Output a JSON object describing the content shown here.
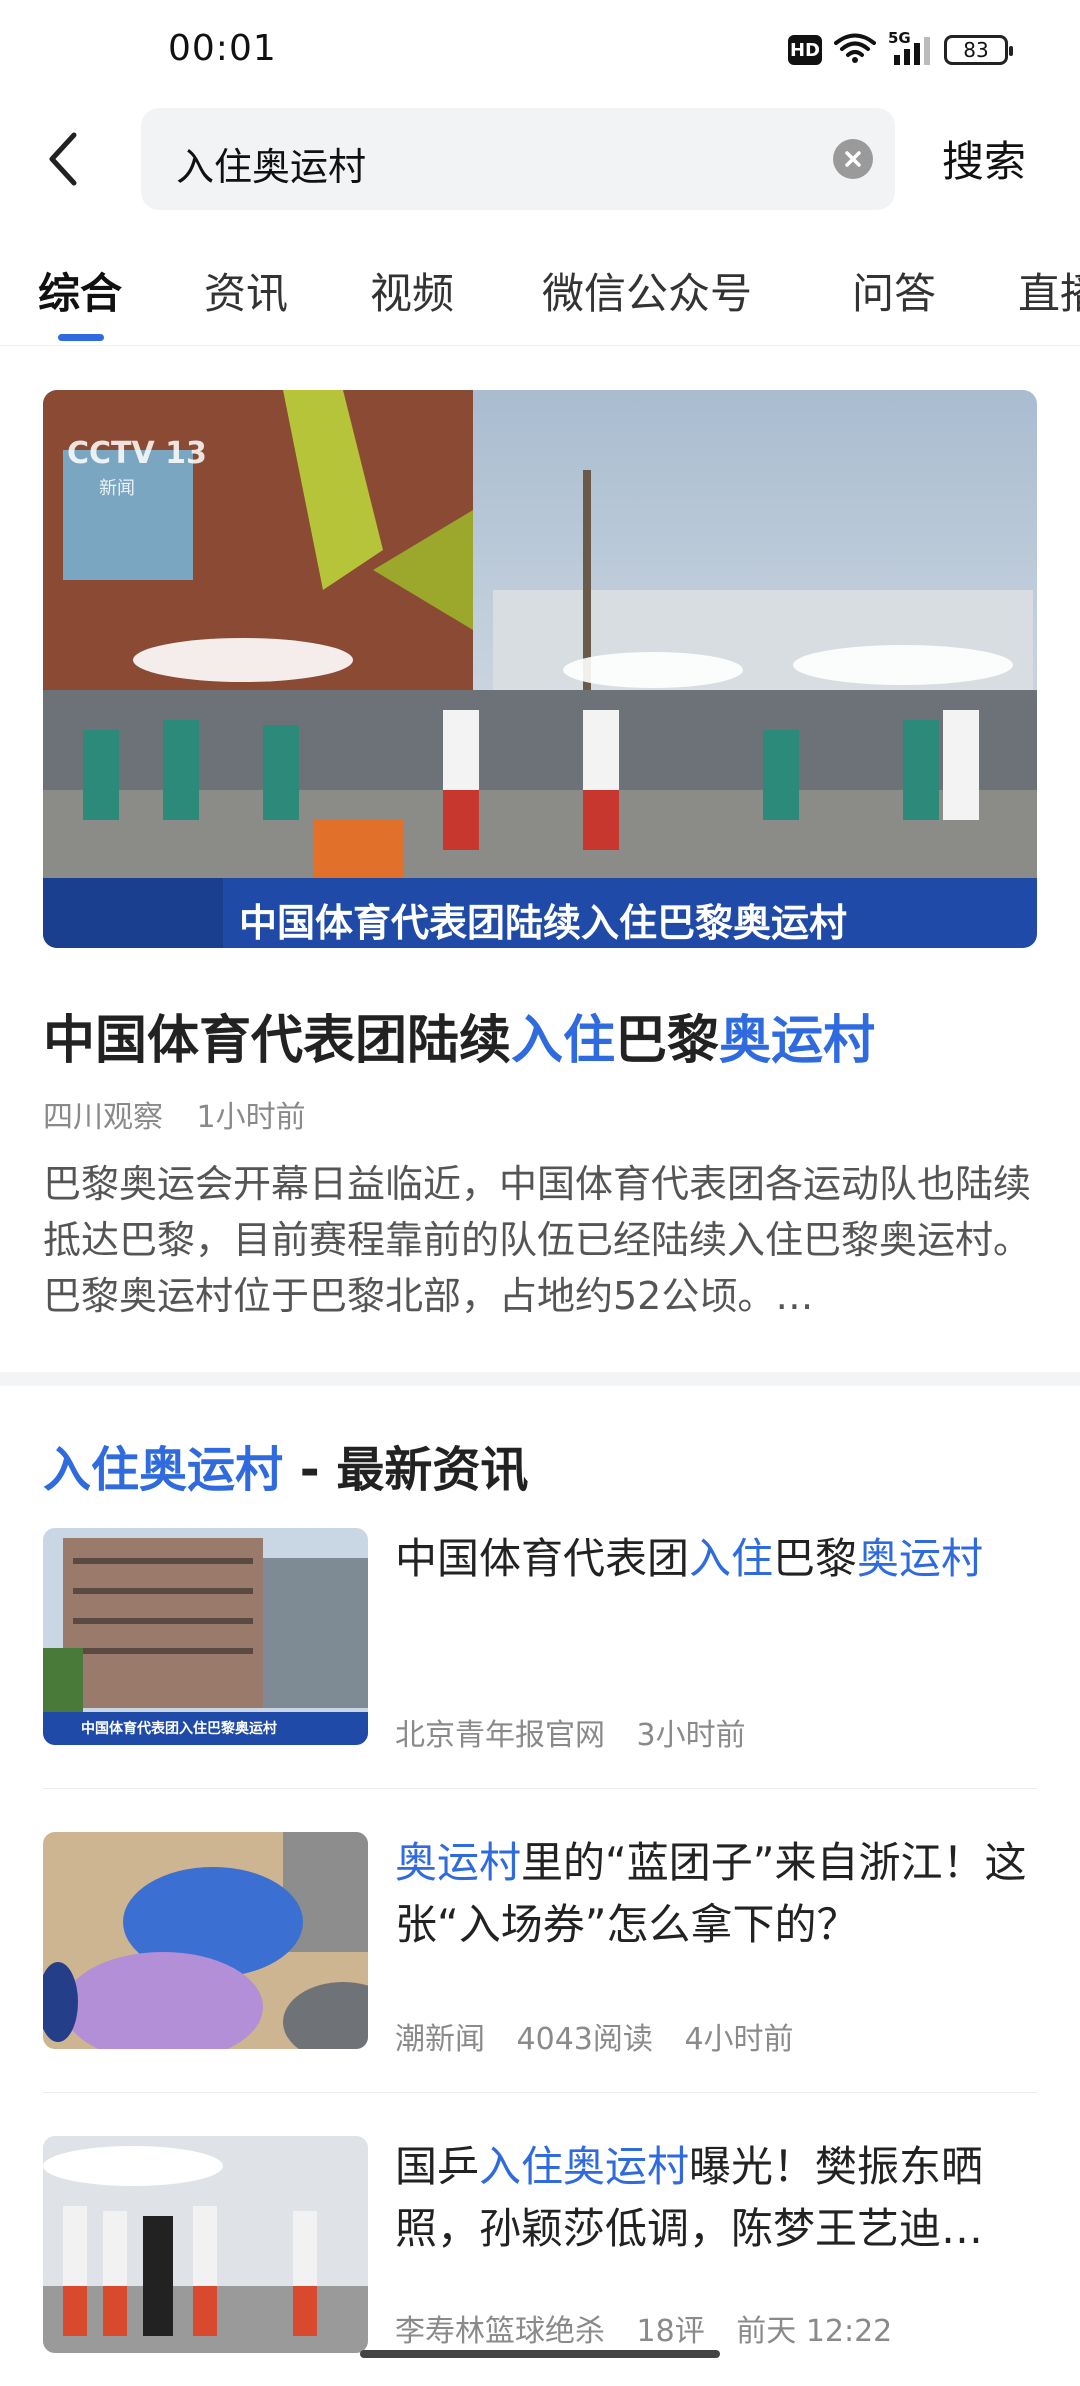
{
  "status_bar": {
    "time": "00:01",
    "hd": "HD",
    "network": "5G",
    "battery": "83"
  },
  "search": {
    "query": "入住奥运村",
    "button": "搜索"
  },
  "tabs": [
    "综合",
    "资讯",
    "视频",
    "微信公众号",
    "问答",
    "直播"
  ],
  "top_article": {
    "image_caption": "中国体育代表团陆续入住巴黎奥运村",
    "image_logo": "CCTV 13",
    "image_logo_sub": "新闻",
    "title_parts": [
      "中国体育代表团陆续",
      "入住",
      "巴黎",
      "奥运村"
    ],
    "source": "四川观察",
    "time": "1小时前",
    "summary": "巴黎奥运会开幕日益临近，中国体育代表团各运动队也陆续抵达巴黎，目前赛程靠前的队伍已经陆续入住巴黎奥运村。巴黎奥运村位于巴黎北部，占地约52公顷。…"
  },
  "news_section": {
    "title_highlight": "入住奥运村",
    "title_rest": " - 最新资讯",
    "items": [
      {
        "title_parts": [
          "中国体育代表团",
          "入住",
          "巴黎",
          "奥运村"
        ],
        "source": "北京青年报官网",
        "reads": "",
        "time": "3小时前",
        "thumb_caption": "中国体育代表团入住巴黎奥运村"
      },
      {
        "title_parts": [
          "奥运村",
          "里的“蓝团子”来自浙江！这张“入场券”怎么拿下的？"
        ],
        "source": "潮新闻",
        "reads": "4043阅读",
        "time": "4小时前"
      },
      {
        "title_parts": [
          "国乒",
          "入住奥运村",
          "曝光！樊振东晒照，孙颖莎低调，陈梦王艺迪…"
        ],
        "source": "李寿林篮球绝杀",
        "reads": "18评",
        "time": "前天 12:22"
      }
    ]
  },
  "colors": {
    "accent": "#2f6bdf",
    "text": "#222222",
    "meta": "#8a8a8a"
  }
}
